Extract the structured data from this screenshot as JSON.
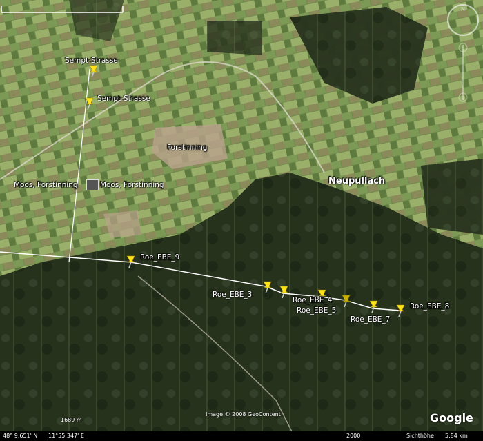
{
  "placemarks": [
    {
      "label": "Sempt-Strasse",
      "kind": "pushpin"
    },
    {
      "label": "Sempt-Strasse",
      "kind": "pushpin"
    },
    {
      "label": "Moos, Forstinning",
      "kind": "square-icon"
    },
    {
      "label": "Moos, Forstinning",
      "kind": "square-icon"
    },
    {
      "label": "Roe_EBE_9",
      "kind": "pushpin"
    },
    {
      "label": "Roe_EBE_3",
      "kind": "pushpin"
    },
    {
      "label": "Roe_EBE_4",
      "kind": "pushpin"
    },
    {
      "label": "Roe_EBE_5",
      "kind": "pushpin"
    },
    {
      "label": "Roe_EBE_7",
      "kind": "pushpin"
    },
    {
      "label": "Roe_EBE_8",
      "kind": "pushpin"
    }
  ],
  "towns": {
    "forstinning": "Forstinning",
    "neupullach": "Neupullach"
  },
  "scale_label": "1689 m",
  "credit": "Image © 2008 GeoContent",
  "logo": "Google",
  "status": {
    "lat": "48° 9.651' N",
    "lon": "11°55.347' E",
    "year": "2000",
    "eye_label": "Sichthöhe",
    "eye_value": "5.84 km"
  },
  "colors": {
    "pin": "#ffe21a",
    "path": "#ffffff",
    "forest": "#27321d",
    "fields": "#6f8a4c"
  },
  "icons": [
    "compass-icon",
    "pushpin-icon",
    "square-icon",
    "navigation-control-icon"
  ]
}
